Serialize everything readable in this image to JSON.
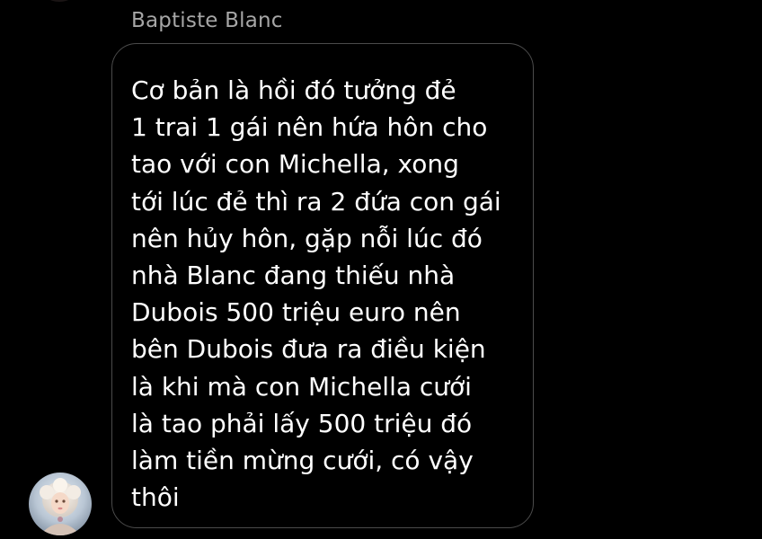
{
  "message": {
    "sender_name": "Baptiste Blanc",
    "lines": [
      "Cơ bản là hồi đó tưởng đẻ",
      "1 trai 1 gái nên hứa hôn cho",
      "tao với con Michella, xong",
      "tới lúc đẻ thì ra 2 đứa con gái",
      "nên hủy hôn, gặp nỗi lúc đó",
      "nhà Blanc đang thiếu nhà",
      "Dubois 500 triệu euro nên",
      "bên Dubois đưa ra điều kiện",
      "là khi mà con Michella cưới",
      "là tao phải lấy 500 triệu đó",
      "làm tiền mừng cưới, có vậy",
      "thôi"
    ]
  },
  "colors": {
    "background": "#000000",
    "bubble_border": "#4b4b4b",
    "text": "#ffffff",
    "sender_name": "#a6a6a6"
  },
  "icons": {
    "avatar": "user-avatar-photo"
  }
}
